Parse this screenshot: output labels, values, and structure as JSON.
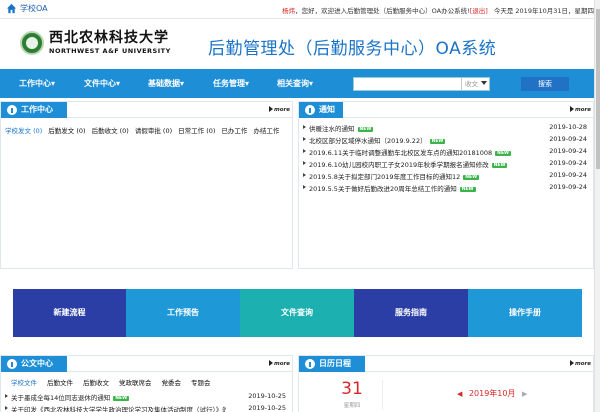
{
  "topbar": {
    "home_label": "学校OA",
    "user_name": "杨炜",
    "greeting": "，您好，欢迎进入后勤管理处（后勤服务中心）OA办公系统!",
    "logout": "[退出]",
    "date_text": "今天是 2019年10月31日，星期四"
  },
  "header": {
    "logo_cn": "西北农林科技大学",
    "logo_en": "NORTHWEST A&F UNIVERSITY",
    "system_name": "后勤管理处（后勤服务中心）OA系统"
  },
  "nav": {
    "items": [
      "工作中心▾",
      "文件中心▾",
      "基础数据▾",
      "任务管理▾",
      "相关查询▾"
    ],
    "search_scope": "收文",
    "search_button": "搜索"
  },
  "work_center": {
    "title": "工作中心",
    "more": "more",
    "tabs": [
      "学校发文 (0)",
      "后勤发文 (0)",
      "后勤收文 (0)",
      "请假审批 (0)",
      "日常工作 (0)",
      "已办工作",
      "办结工作"
    ]
  },
  "notice": {
    "title": "通知",
    "more": "more",
    "new_badge": "NEW",
    "items": [
      {
        "title": "供暖注水的通知",
        "date": "2019-10-28",
        "new": true
      },
      {
        "title": "北校区部分区域停水通知（2019.9.22）",
        "date": "2019-09-24",
        "new": true
      },
      {
        "title": "2019.6.11关于临时调整通勤车北校区发车点的通知20181008",
        "date": "2019-09-24",
        "new": true
      },
      {
        "title": "2019.6.10幼儿园校内职工子女2019年秋季学期报名通知修改",
        "date": "2019-09-24",
        "new": true
      },
      {
        "title": "2019.5.8关于拟定部门2019年度工作目标的通知12",
        "date": "2019-09-24",
        "new": true
      },
      {
        "title": "2019.5.5关于做好后勤改进20周年总结工作的通知",
        "date": "2019-09-24",
        "new": true
      }
    ]
  },
  "tiles": [
    {
      "label": "新建流程",
      "color": "#2a3ea6"
    },
    {
      "label": "工作预告",
      "color": "#1f98d8"
    },
    {
      "label": "文件查询",
      "color": "#1cb0b0"
    },
    {
      "label": "服务指南",
      "color": "#2a3ea6"
    },
    {
      "label": "操作手册",
      "color": "#1f98d8"
    }
  ],
  "doc_center": {
    "title": "公文中心",
    "more": "more",
    "tabs": [
      "学校文件",
      "后勤文件",
      "后勤收文",
      "党政联席会",
      "党委会",
      "专题会"
    ],
    "items": [
      {
        "title": "关于墨成全每14位同志退休的通知",
        "date": "2019-10-25",
        "new": true
      },
      {
        "title": "关于印发《西北农林科技大学学生政治理论学习及集体活动制度（试行）》的...",
        "date": "2019-10-25",
        "new": false
      }
    ]
  },
  "calendar": {
    "title": "日历日程",
    "more": "more",
    "day": "31",
    "weekday": "星期四",
    "month": "2019年10月",
    "prev": "◀",
    "next": "▶"
  }
}
